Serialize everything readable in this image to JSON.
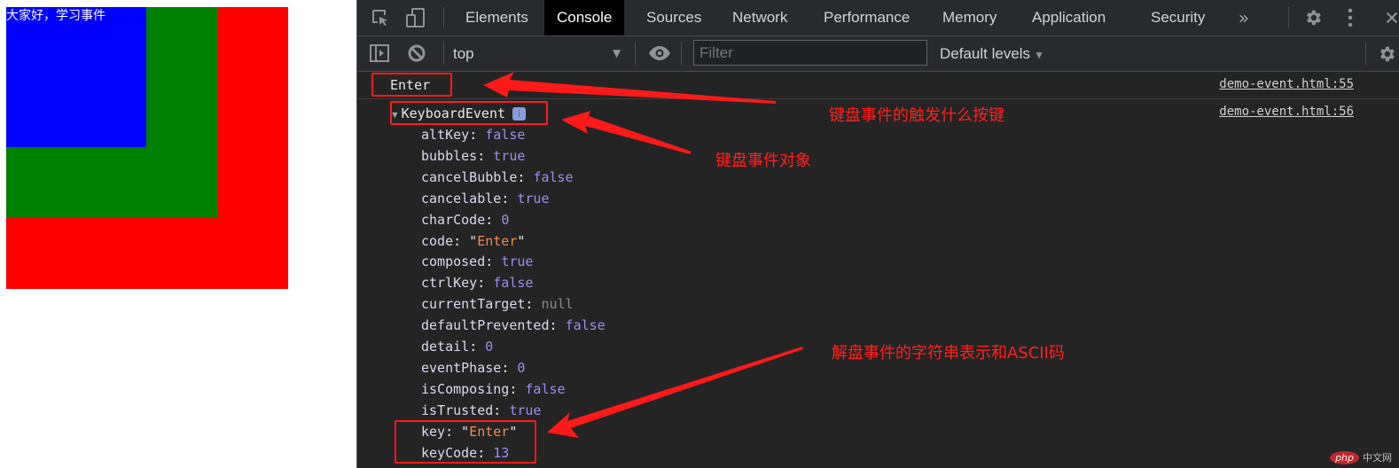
{
  "page": {
    "heading_text": "大家好，学习事件",
    "boxes": [
      {
        "name": "outer",
        "color": "#ff0000"
      },
      {
        "name": "middle",
        "color": "#008000"
      },
      {
        "name": "inner",
        "color": "#0000ff"
      }
    ]
  },
  "devtools": {
    "tabs": [
      {
        "label": "Elements",
        "active": false
      },
      {
        "label": "Console",
        "active": true
      },
      {
        "label": "Sources",
        "active": false
      },
      {
        "label": "Network",
        "active": false
      },
      {
        "label": "Performance",
        "active": false
      },
      {
        "label": "Memory",
        "active": false
      },
      {
        "label": "Application",
        "active": false
      },
      {
        "label": "Security",
        "active": false
      }
    ],
    "more_tabs_icon": "»",
    "icons": {
      "inspect": "inspect-element-icon",
      "device": "device-toolbar-icon",
      "settings": "gear-icon",
      "menu": "kebab-menu-icon",
      "close": "close-icon",
      "sidebar": "show-sidebar-icon",
      "clear": "clear-console-icon",
      "eye": "live-expression-icon"
    },
    "toolbar": {
      "context": "top",
      "filter_placeholder": "Filter",
      "levels": "Default levels"
    },
    "console": {
      "log1": {
        "text": "Enter",
        "source": "demo-event.html:55"
      },
      "log2": {
        "object_name": "KeyboardEvent",
        "info_badge": "i",
        "source": "demo-event.html:56",
        "properties": [
          {
            "key": "altKey",
            "value": "false",
            "type": "bool"
          },
          {
            "key": "bubbles",
            "value": "true",
            "type": "bool"
          },
          {
            "key": "cancelBubble",
            "value": "false",
            "type": "bool"
          },
          {
            "key": "cancelable",
            "value": "true",
            "type": "bool"
          },
          {
            "key": "charCode",
            "value": "0",
            "type": "num"
          },
          {
            "key": "code",
            "value": "Enter",
            "type": "str"
          },
          {
            "key": "composed",
            "value": "true",
            "type": "bool"
          },
          {
            "key": "ctrlKey",
            "value": "false",
            "type": "bool"
          },
          {
            "key": "currentTarget",
            "value": "null",
            "type": "null"
          },
          {
            "key": "defaultPrevented",
            "value": "false",
            "type": "bool"
          },
          {
            "key": "detail",
            "value": "0",
            "type": "num"
          },
          {
            "key": "eventPhase",
            "value": "0",
            "type": "num"
          },
          {
            "key": "isComposing",
            "value": "false",
            "type": "bool"
          },
          {
            "key": "isTrusted",
            "value": "true",
            "type": "bool"
          },
          {
            "key": "key",
            "value": "Enter",
            "type": "str"
          },
          {
            "key": "keyCode",
            "value": "13",
            "type": "num"
          }
        ]
      }
    }
  },
  "annotations": {
    "note1": "键盘事件的触发什么按键",
    "note2": "键盘事件对象",
    "note3": "解盘事件的字符串表示和ASCII码",
    "color": "#ff1a1a"
  },
  "watermark": {
    "logo": "php",
    "text": "中文网"
  }
}
